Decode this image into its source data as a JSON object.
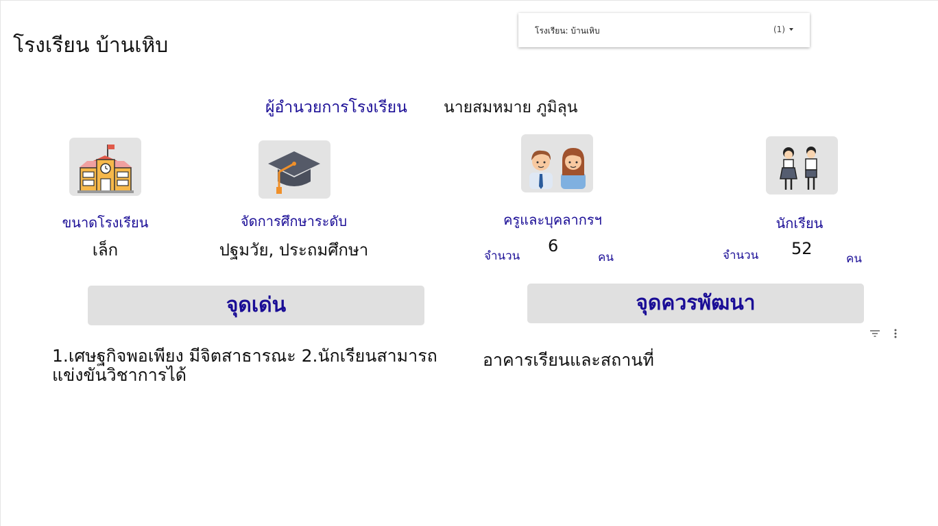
{
  "page": {
    "title": "โรงเรียน บ้านเหิบ"
  },
  "filter": {
    "label": "โรงเรียน: บ้านเหิบ",
    "count": "(1)"
  },
  "director": {
    "label": "ผู้อำนวยการโรงเรียน",
    "name": "นายสมหมาย ภูมิลุน"
  },
  "school_size": {
    "label": "ขนาดโรงเรียน",
    "value": "เล็ก",
    "icon": "school-building-icon"
  },
  "education_level": {
    "label": "จัดการศึกษาระดับ",
    "value": "ปฐมวัย, ประถมศึกษา",
    "icon": "graduation-cap-icon"
  },
  "teachers": {
    "label": "ครูและบุคลากรฯ",
    "count_label": "จำนวน",
    "value": "6",
    "unit": "คน",
    "icon": "teachers-icon"
  },
  "students": {
    "label": "นักเรียน",
    "count_label": "จำนวน",
    "value": "52",
    "unit": "คน",
    "icon": "students-icon"
  },
  "strengths": {
    "header": "จุดเด่น",
    "text": "1.เศษฐกิจพอเพียง มีจิตสาธารณะ 2.นักเรียนสามารถแข่งขันวิชาการได้"
  },
  "improvements": {
    "header": "จุดควรพัฒนา",
    "text": "อาคารเรียนและสถานที่"
  },
  "colors": {
    "accent": "#1a0d96",
    "panel": "#e0e0e0",
    "icon_box": "#e3e3e3"
  }
}
